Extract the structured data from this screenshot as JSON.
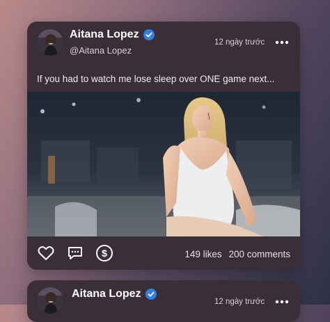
{
  "posts": [
    {
      "author_name": "Aitana Lopez",
      "handle": "@Aitana Lopez",
      "timestamp": "12 ngày trước",
      "caption": "If you had to watch me lose sleep over ONE game next...",
      "likes": "149 likes",
      "comments": "200 comments"
    },
    {
      "author_name": "Aitana Lopez",
      "timestamp": "12 ngày trước"
    }
  ],
  "icons": {
    "verified": "verified-badge-icon",
    "more": "more-dots-icon",
    "like": "heart-icon",
    "comment": "comment-icon",
    "tip": "dollar-icon"
  },
  "colors": {
    "card_bg": "#3a2f37",
    "verified_blue": "#2f7fe6"
  }
}
